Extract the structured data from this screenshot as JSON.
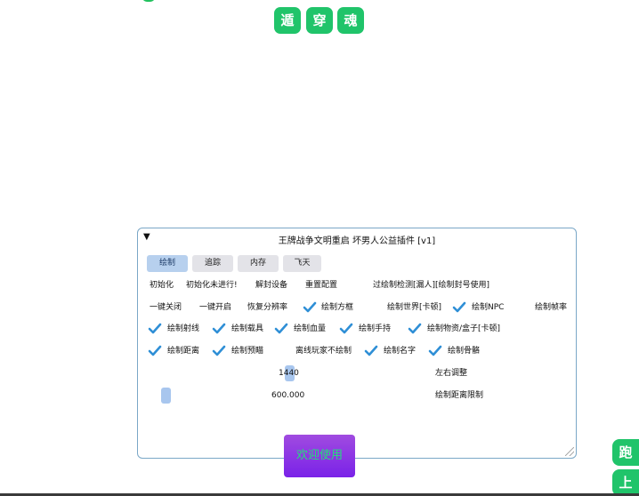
{
  "top_buttons": [
    {
      "label": "遁"
    },
    {
      "label": "穿"
    },
    {
      "label": "魂"
    }
  ],
  "side_buttons": {
    "run": "跑",
    "up": "上"
  },
  "panel": {
    "title": "王牌战争文明重启 坏男人公益插件 [v1]",
    "collapse_icon": "▼",
    "tabs": [
      {
        "label": "绘制",
        "active": true
      },
      {
        "label": "追踪",
        "active": false
      },
      {
        "label": "内存",
        "active": false
      },
      {
        "label": "飞天",
        "active": false
      }
    ],
    "row1": [
      "初始化",
      "初始化未进行!",
      "解封设备",
      "重置配置",
      "过绘制检测[漏人][绘制封号使用]"
    ],
    "row2": {
      "plain": [
        "一键关闭",
        "一键开启",
        "恢复分辨率"
      ],
      "draw_box": "绘制方框",
      "draw_world": "绘制世界[卡顿]",
      "draw_npc": "绘制NPC",
      "draw_fps": "绘制帧率"
    },
    "row3": [
      "绘制射线",
      "绘制载具",
      "绘制血量",
      "绘制手持",
      "绘制物资/盒子[卡顿]"
    ],
    "row4": {
      "draw_distance": "绘制距离",
      "draw_aim": "绘制预瞄",
      "offline_player": "离线玩家不绘制",
      "draw_name": "绘制名字",
      "draw_skeleton": "绘制骨骼"
    },
    "slider1": {
      "value": "1440",
      "label": "左右调整"
    },
    "slider2": {
      "value": "600.000",
      "label": "绘制距离限制"
    }
  },
  "welcome_button": "欢迎使用",
  "colors": {
    "accent_green": "#20c46a",
    "check_blue": "#2f8fd6",
    "tab_active": "#b7d0ee",
    "welcome_purple": "#7a22e8"
  }
}
